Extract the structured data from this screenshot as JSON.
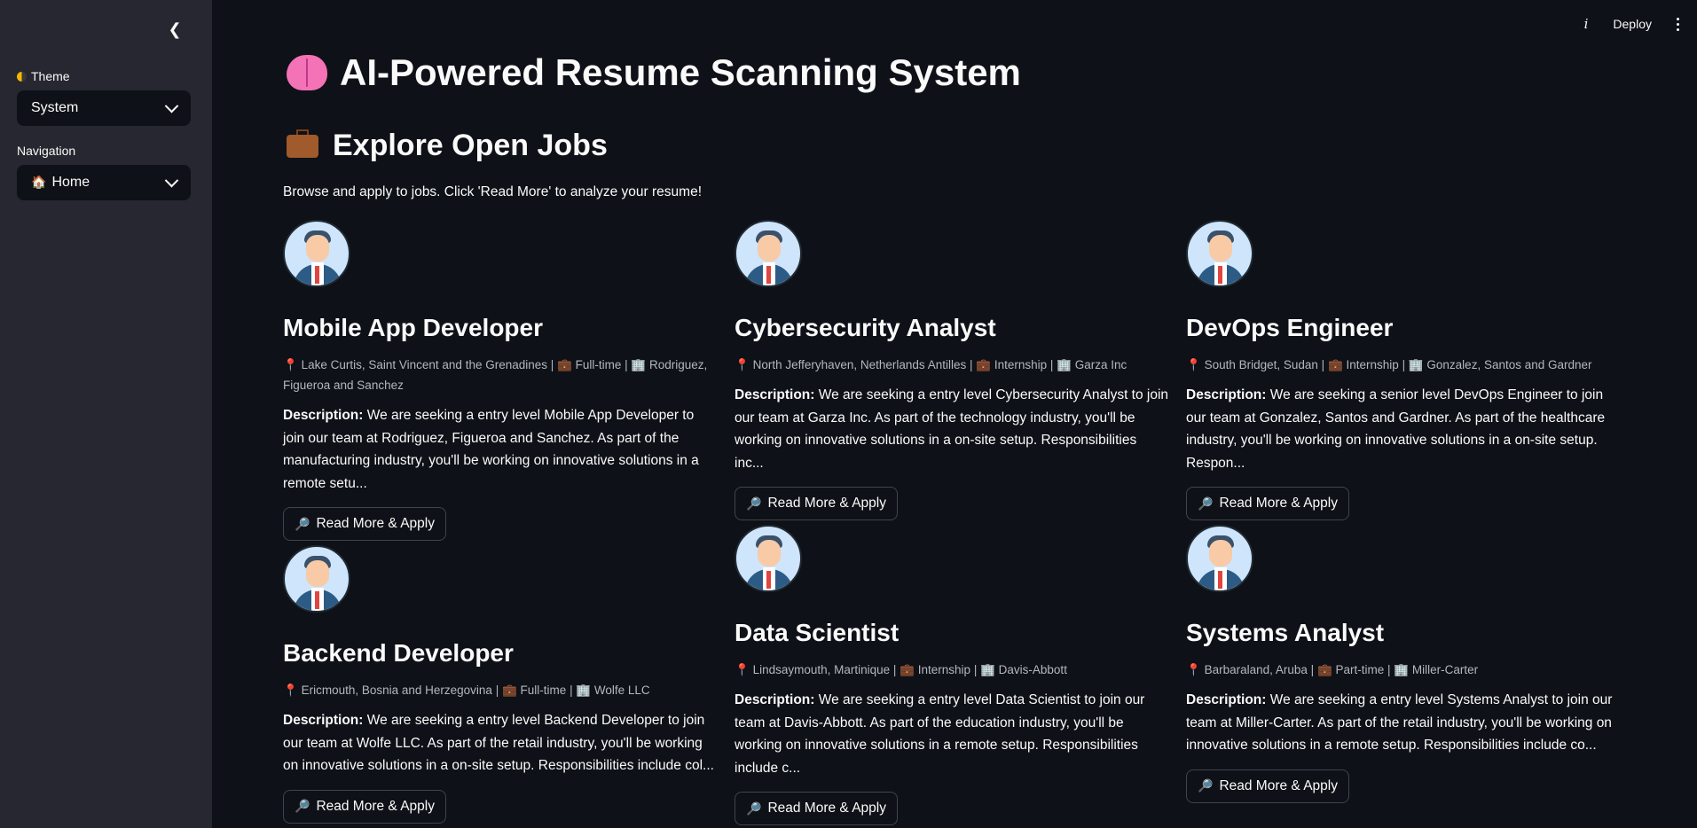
{
  "sidebar": {
    "collapse_icon": "chevron-left-icon",
    "theme_label": "Theme",
    "theme_value": "System",
    "nav_label": "Navigation",
    "nav_value": "Home"
  },
  "header": {
    "deploy_label": "Deploy"
  },
  "main": {
    "title": "AI-Powered Resume Scanning System",
    "subtitle": "Explore Open Jobs",
    "intro": "Browse and apply to jobs. Click 'Read More' to analyze your resume!",
    "button_label": "Read More & Apply",
    "description_label": "Description:"
  },
  "jobs": [
    {
      "title": "Mobile App Developer",
      "location": "Lake Curtis, Saint Vincent and the Grenadines",
      "type": "Full-time",
      "company": "Rodriguez, Figueroa and Sanchez",
      "description": "We are seeking a entry level Mobile App Developer to join our team at Rodriguez, Figueroa and Sanchez. As part of the manufacturing industry, you'll be working on innovative solutions in a remote setu..."
    },
    {
      "title": "Cybersecurity Analyst",
      "location": "North Jefferyhaven, Netherlands Antilles",
      "type": "Internship",
      "company": "Garza Inc",
      "description": "We are seeking a entry level Cybersecurity Analyst to join our team at Garza Inc. As part of the technology industry, you'll be working on innovative solutions in a on-site setup. Responsibilities inc..."
    },
    {
      "title": "DevOps Engineer",
      "location": "South Bridget, Sudan",
      "type": "Internship",
      "company": "Gonzalez, Santos and Gardner",
      "description": "We are seeking a senior level DevOps Engineer to join our team at Gonzalez, Santos and Gardner. As part of the healthcare industry, you'll be working on innovative solutions in a on-site setup. Respon..."
    },
    {
      "title": "Backend Developer",
      "location": "Ericmouth, Bosnia and Herzegovina",
      "type": "Full-time",
      "company": "Wolfe LLC",
      "description": "We are seeking a entry level Backend Developer to join our team at Wolfe LLC. As part of the retail industry, you'll be working on innovative solutions in a on-site setup. Responsibilities include col..."
    },
    {
      "title": "Data Scientist",
      "location": "Lindsaymouth, Martinique",
      "type": "Internship",
      "company": "Davis-Abbott",
      "description": "We are seeking a entry level Data Scientist to join our team at Davis-Abbott. As part of the education industry, you'll be working on innovative solutions in a remote setup. Responsibilities include c..."
    },
    {
      "title": "Systems Analyst",
      "location": "Barbaraland, Aruba",
      "type": "Part-time",
      "company": "Miller-Carter",
      "description": "We are seeking a entry level Systems Analyst to join our team at Miller-Carter. As part of the retail industry, you'll be working on innovative solutions in a remote setup. Responsibilities include co..."
    }
  ]
}
